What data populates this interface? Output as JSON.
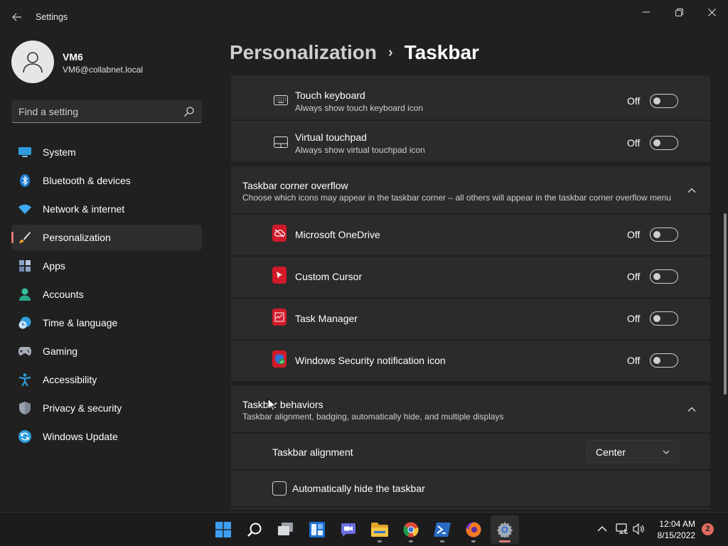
{
  "window": {
    "title": "Settings",
    "controls": {
      "minimize": "minimize-icon",
      "maximize": "restore-icon",
      "close": "close-icon"
    }
  },
  "user": {
    "name": "VM6",
    "email": "VM6@collabnet.local"
  },
  "search": {
    "placeholder": "Find a setting"
  },
  "sidebar": {
    "items": [
      {
        "label": "System",
        "icon": "system-icon",
        "selected": false
      },
      {
        "label": "Bluetooth & devices",
        "icon": "bluetooth-icon",
        "selected": false
      },
      {
        "label": "Network & internet",
        "icon": "wifi-icon",
        "selected": false
      },
      {
        "label": "Personalization",
        "icon": "brush-icon",
        "selected": true
      },
      {
        "label": "Apps",
        "icon": "apps-icon",
        "selected": false
      },
      {
        "label": "Accounts",
        "icon": "accounts-icon",
        "selected": false
      },
      {
        "label": "Time & language",
        "icon": "time-language-icon",
        "selected": false
      },
      {
        "label": "Gaming",
        "icon": "gamepad-icon",
        "selected": false
      },
      {
        "label": "Accessibility",
        "icon": "accessibility-icon",
        "selected": false
      },
      {
        "label": "Privacy & security",
        "icon": "shield-icon",
        "selected": false
      },
      {
        "label": "Windows Update",
        "icon": "update-icon",
        "selected": false
      }
    ]
  },
  "breadcrumb": {
    "parent": "Personalization",
    "separator": "›",
    "current": "Taskbar"
  },
  "system_tray_icons": {
    "rows": [
      {
        "title": "Touch keyboard",
        "subtitle": "Always show touch keyboard icon",
        "state": "Off",
        "icon": "keyboard-icon"
      },
      {
        "title": "Virtual touchpad",
        "subtitle": "Always show virtual touchpad icon",
        "state": "Off",
        "icon": "touchpad-icon"
      }
    ]
  },
  "corner_overflow": {
    "title": "Taskbar corner overflow",
    "subtitle": "Choose which icons may appear in the taskbar corner – all others will appear in the taskbar corner overflow menu",
    "rows": [
      {
        "title": "Microsoft OneDrive",
        "state": "Off",
        "icon": "onedrive-icon"
      },
      {
        "title": "Custom Cursor",
        "state": "Off",
        "icon": "custom-cursor-icon"
      },
      {
        "title": "Task Manager",
        "state": "Off",
        "icon": "task-manager-icon"
      },
      {
        "title": "Windows Security notification icon",
        "state": "Off",
        "icon": "windows-security-icon"
      }
    ]
  },
  "behaviors": {
    "title": "Taskbar behaviors",
    "subtitle": "Taskbar alignment, badging, automatically hide, and multiple displays",
    "alignment": {
      "label": "Taskbar alignment",
      "value": "Center"
    },
    "autohide": {
      "label": "Automatically hide the taskbar",
      "checked": false
    }
  },
  "taskbar": {
    "apps": [
      "start-icon",
      "search-icon",
      "task-view-icon",
      "widgets-icon",
      "teams-chat-icon",
      "file-explorer-icon",
      "chrome-icon",
      "powershell-icon",
      "firefox-icon",
      "settings-icon"
    ],
    "time": "12:04 AM",
    "date": "8/15/2022",
    "notifications": "2"
  },
  "colors": {
    "accent": "#e37b7b",
    "background": "#202020",
    "card": "#2b2b2b",
    "app_icon_red": "#d11a2a"
  }
}
